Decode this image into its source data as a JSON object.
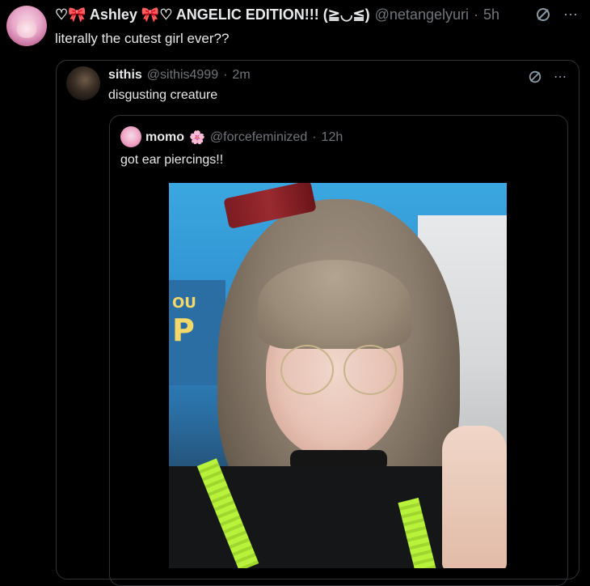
{
  "tweet": {
    "display_name": "♡🎀 Ashley 🎀♡ ANGELIC EDITION!!! (≧◡≦)",
    "handle": "@netangelyuri",
    "separator": "·",
    "time": "5h",
    "text": "literally the cutest girl ever??"
  },
  "quote1": {
    "display_name": "sithis",
    "handle": "@sithis4999",
    "separator": "·",
    "time": "2m",
    "text": "disgusting creature"
  },
  "quote2": {
    "display_name": "momo",
    "badge": "🌸",
    "handle": "@forcefeminized",
    "separator": "·",
    "time": "12h",
    "text": "got ear piercings!!"
  },
  "photo": {
    "sign_text_line1": "OU",
    "sign_text_line2": "P"
  },
  "icons": {
    "more": "⋯",
    "grok": "⌀",
    "accent": "#71767b"
  }
}
